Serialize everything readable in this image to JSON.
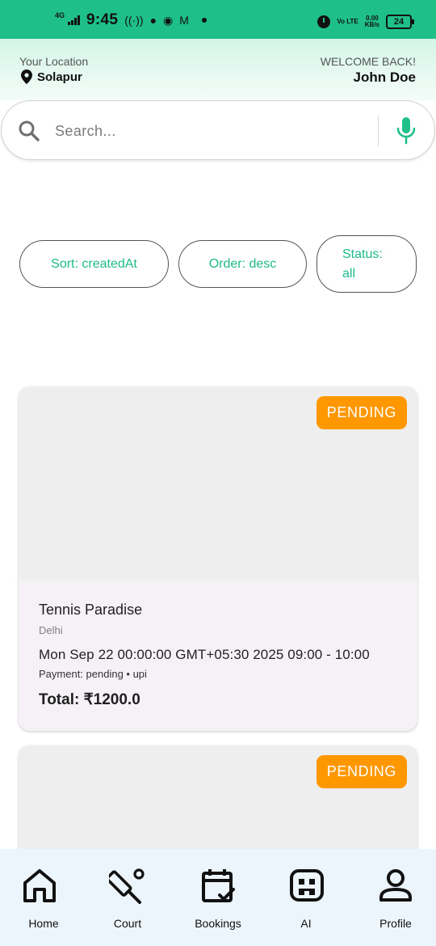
{
  "status_bar": {
    "network": "4G",
    "time": "9:45",
    "volte": "Vo LTE",
    "speed_value": "0.00",
    "speed_unit": "KB/s",
    "battery": "24"
  },
  "header": {
    "location_label": "Your Location",
    "location_value": "Solapur",
    "welcome": "WELCOME BACK!",
    "user_name": "John Doe"
  },
  "search": {
    "placeholder": "Search..."
  },
  "filters": {
    "sort_label": "Sort: createdAt",
    "order_label": "Order: desc",
    "status_label": "Status: all"
  },
  "bookings": [
    {
      "status": "PENDING",
      "venue": "Tennis Paradise",
      "city": "Delhi",
      "date": "Mon Sep 22 00:00:00 GMT+05:30 2025  09:00 - 10:00",
      "payment": "Payment: pending • upi",
      "total": "Total: ₹1200.0"
    },
    {
      "status": "PENDING"
    }
  ],
  "nav": {
    "home": "Home",
    "court": "Court",
    "bookings": "Bookings",
    "ai": "AI",
    "profile": "Profile"
  },
  "colors": {
    "accent": "#1fbf8a",
    "pending": "#ff9800",
    "chip_text": "#1db98a",
    "nav_bg": "#edf5fc"
  },
  "icons": [
    "location-pin-icon",
    "search-icon",
    "mic-icon",
    "home-icon",
    "court-icon",
    "bookings-icon",
    "ai-icon",
    "profile-icon"
  ]
}
